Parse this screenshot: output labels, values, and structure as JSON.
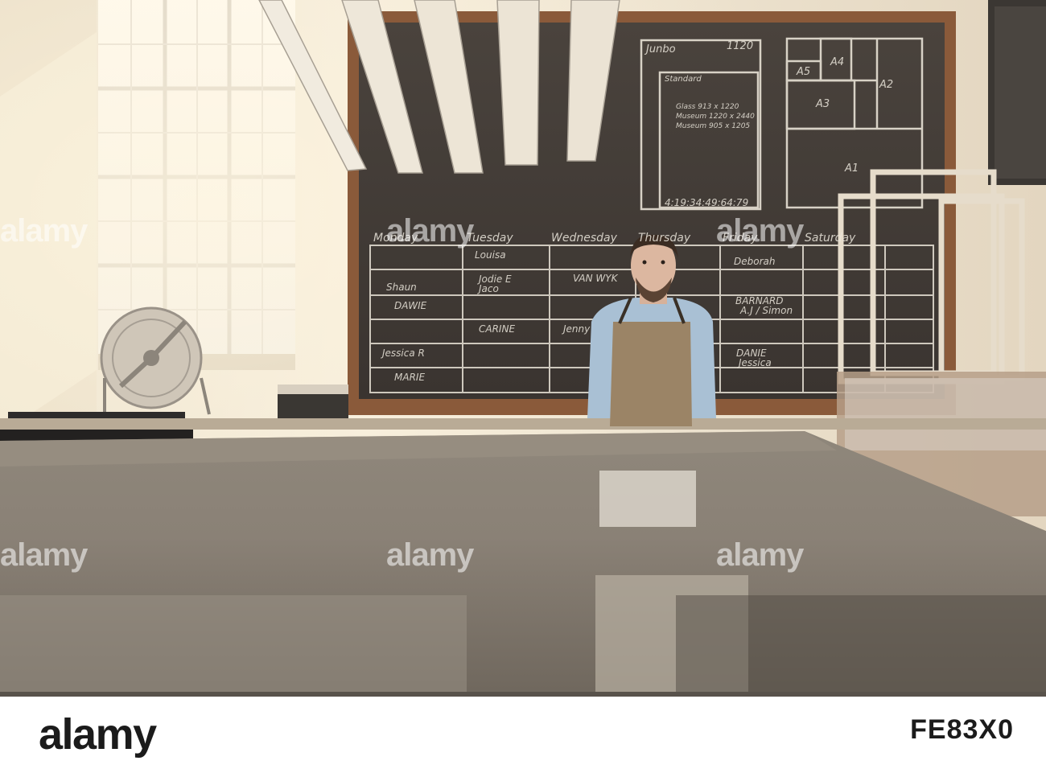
{
  "photo": {
    "description_icon": "workshop-photo",
    "watermarks": [
      "alamy",
      "alamy",
      "alamy",
      "alamy",
      "alamy",
      "alamy"
    ],
    "chalkboard": {
      "days": [
        "Monday",
        "Tuesday",
        "Wednesday",
        "Thursday",
        "Friday",
        "Saturday"
      ],
      "size_labels": [
        "Junbo",
        "1120",
        "Standard",
        "A4",
        "A5",
        "A3",
        "A2",
        "A1",
        "4:19:34:49:64:79"
      ],
      "glass_note": [
        "Glass 913 x 1220",
        "Museum 1220 x 2440",
        "Museum 905 x 1205"
      ],
      "cells": [
        "Louisa",
        "Shaun",
        "Jodie E",
        "Jaco",
        "VAN WYK",
        "BARNARD",
        "A.J / Simon",
        "DAWIE",
        "CARINE",
        "Jenny",
        "Jessica R",
        "DANIE",
        "Jessica",
        "MARIE",
        "Deborah"
      ]
    }
  },
  "footer": {
    "brand": "alamy",
    "image_id": "FE83X0"
  }
}
